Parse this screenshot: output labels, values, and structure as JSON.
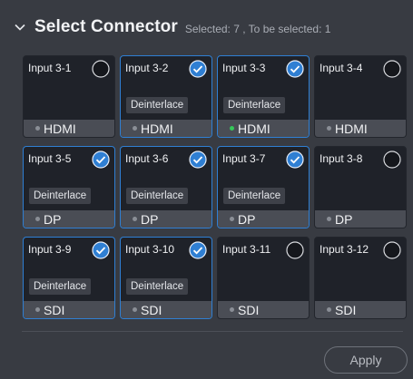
{
  "header": {
    "title": "Select Connector",
    "subtitle": "Selected: 7 ,  To be selected: 1"
  },
  "colors": {
    "accent": "#2f7fd3",
    "active_dot": "#35c759",
    "inactive_dot": "#8a8e96"
  },
  "cards": [
    {
      "name": "Input 3-1",
      "selected": false,
      "badge": "",
      "type": "HDMI",
      "active": false
    },
    {
      "name": "Input 3-2",
      "selected": true,
      "badge": "Deinterlace",
      "type": "HDMI",
      "active": false
    },
    {
      "name": "Input 3-3",
      "selected": true,
      "badge": "Deinterlace",
      "type": "HDMI",
      "active": true
    },
    {
      "name": "Input 3-4",
      "selected": false,
      "badge": "",
      "type": "HDMI",
      "active": false
    },
    {
      "name": "Input 3-5",
      "selected": true,
      "badge": "Deinterlace",
      "type": "DP",
      "active": false
    },
    {
      "name": "Input 3-6",
      "selected": true,
      "badge": "Deinterlace",
      "type": "DP",
      "active": false
    },
    {
      "name": "Input 3-7",
      "selected": true,
      "badge": "Deinterlace",
      "type": "DP",
      "active": false
    },
    {
      "name": "Input 3-8",
      "selected": false,
      "badge": "",
      "type": "DP",
      "active": false
    },
    {
      "name": "Input 3-9",
      "selected": true,
      "badge": "Deinterlace",
      "type": "SDI",
      "active": false
    },
    {
      "name": "Input 3-10",
      "selected": true,
      "badge": "Deinterlace",
      "type": "SDI",
      "active": false
    },
    {
      "name": "Input 3-11",
      "selected": false,
      "badge": "",
      "type": "SDI",
      "active": false
    },
    {
      "name": "Input 3-12",
      "selected": false,
      "badge": "",
      "type": "SDI",
      "active": false
    }
  ],
  "footer": {
    "apply_label": "Apply"
  }
}
